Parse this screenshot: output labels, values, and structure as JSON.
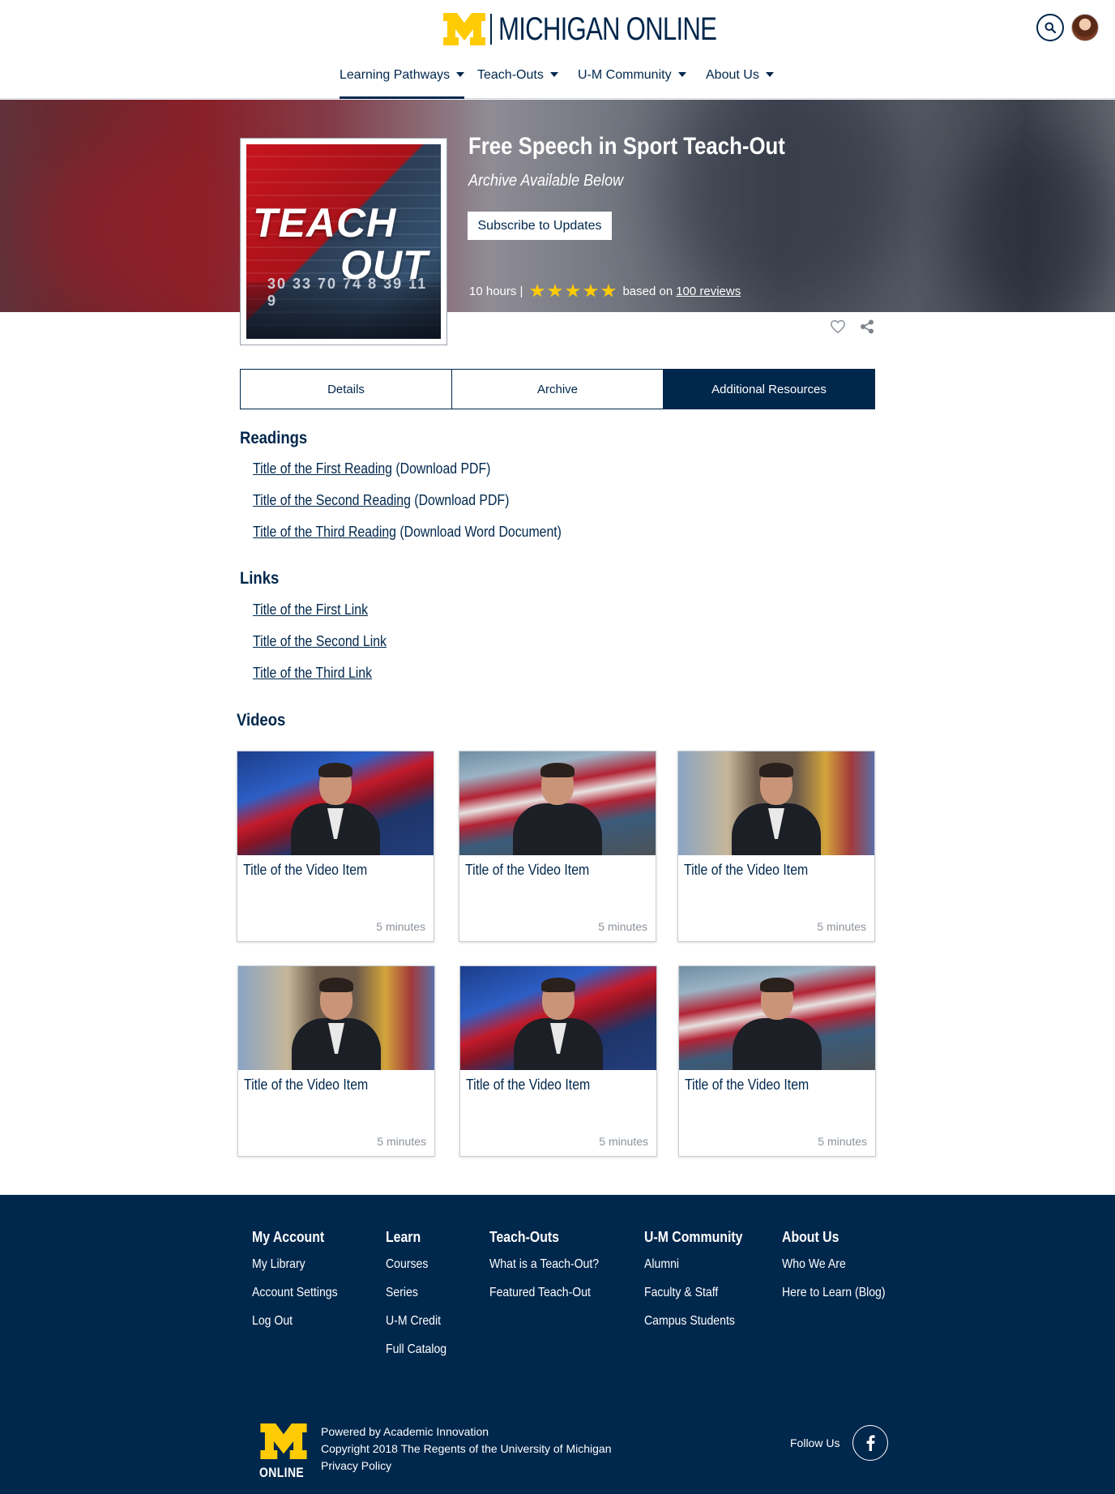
{
  "brand": {
    "wordmark": "MICHIGAN ONLINE",
    "maize": "#ffcb05",
    "blue": "#00274c"
  },
  "nav": {
    "items": [
      {
        "label": "Learning Pathways",
        "active": true
      },
      {
        "label": "Teach-Outs",
        "active": false
      },
      {
        "label": "U-M Community",
        "active": false
      },
      {
        "label": "About Us",
        "active": false
      }
    ]
  },
  "icons": {
    "search": "search-icon",
    "avatar": "user-avatar",
    "favorite": "heart-icon",
    "share": "share-icon",
    "facebook": "facebook-icon"
  },
  "course": {
    "title": "Free Speech in Sport Teach-Out",
    "subtitle": "Archive Available Below",
    "subscribe_label": "Subscribe to Updates",
    "duration": "10 hours |",
    "stars": 5,
    "based_on": "based on",
    "reviews_link": "100 reviews",
    "cover_text_1": "TEACH",
    "cover_text_2": "OUT",
    "cover_numbers": "30 33 70 74 8 39 11 9"
  },
  "tabs": [
    {
      "label": "Details",
      "active": false
    },
    {
      "label": "Archive",
      "active": false
    },
    {
      "label": "Additional Resources",
      "active": true
    }
  ],
  "readings": {
    "heading": "Readings",
    "items": [
      {
        "title": "Title of the First Reading",
        "note": " (Download PDF)"
      },
      {
        "title": "Title of the Second Reading",
        "note": " (Download PDF)"
      },
      {
        "title": "Title of the Third Reading",
        "note": " (Download Word Document)"
      }
    ]
  },
  "links": {
    "heading": "Links",
    "items": [
      {
        "title": "Title of the First Link"
      },
      {
        "title": "Title of the Second Link"
      },
      {
        "title": "Title of the Third Link"
      }
    ]
  },
  "videos": {
    "heading": "Videos",
    "items": [
      {
        "title": "Title of the Video Item",
        "duration": "5 minutes"
      },
      {
        "title": "Title of the Video Item",
        "duration": "5 minutes"
      },
      {
        "title": "Title of the Video Item",
        "duration": "5 minutes"
      },
      {
        "title": "Title of the Video Item",
        "duration": "5 minutes"
      },
      {
        "title": "Title of the Video Item",
        "duration": "5 minutes"
      },
      {
        "title": "Title of the Video Item",
        "duration": "5 minutes"
      }
    ]
  },
  "footer": {
    "columns": [
      {
        "heading": "My Account",
        "links": [
          "My Library",
          "Account Settings",
          "Log Out"
        ]
      },
      {
        "heading": "Learn",
        "links": [
          "Courses",
          "Series",
          "U-M Credit",
          "Full Catalog"
        ]
      },
      {
        "heading": "Teach-Outs",
        "links": [
          "What is a Teach-Out?",
          "Featured Teach-Out"
        ]
      },
      {
        "heading": "U-M Community",
        "links": [
          "Alumni",
          "Faculty & Staff",
          "Campus Students"
        ]
      },
      {
        "heading": "About Us",
        "links": [
          "Who We Are",
          "Here to Learn (Blog)"
        ]
      }
    ],
    "logo_text": "ONLINE",
    "powered_by": "Powered by Academic Innovation",
    "copyright": "Copyright 2018 The Regents of the University of Michigan",
    "privacy": "Privacy Policy",
    "follow_us": "Follow Us"
  }
}
